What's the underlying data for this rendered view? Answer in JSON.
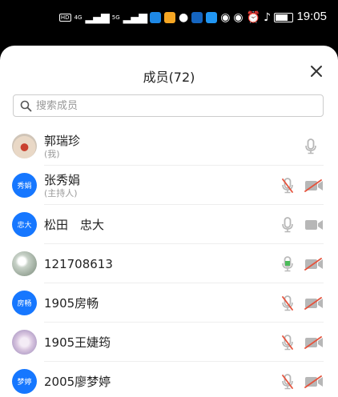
{
  "status": {
    "time": "19:05",
    "signal_a": "4G",
    "signal_b": "5G"
  },
  "header": {
    "title": "成员(72)",
    "close": "✕"
  },
  "search": {
    "placeholder": "搜索成员"
  },
  "members": [
    {
      "name": "郭瑞珍",
      "sub": "(我)",
      "avatar": "photo1",
      "avatar_text": "",
      "mic": "gray",
      "cam": "none"
    },
    {
      "name": "张秀娟",
      "sub": "(主持人)",
      "avatar": "blue",
      "avatar_text": "秀娟",
      "mic": "muted",
      "cam": "off"
    },
    {
      "name": "松田　忠大",
      "sub": "",
      "avatar": "blue",
      "avatar_text": "忠大",
      "mic": "gray",
      "cam": "on"
    },
    {
      "name": "121708613",
      "sub": "",
      "avatar": "photo2",
      "avatar_text": "",
      "mic": "green",
      "cam": "off"
    },
    {
      "name": "1905房畅",
      "sub": "",
      "avatar": "blue",
      "avatar_text": "房畅",
      "mic": "muted",
      "cam": "off"
    },
    {
      "name": "1905王婕筠",
      "sub": "",
      "avatar": "photo3",
      "avatar_text": "",
      "mic": "muted",
      "cam": "off"
    },
    {
      "name": "2005廖梦婷",
      "sub": "",
      "avatar": "blue",
      "avatar_text": "梦婷",
      "mic": "muted",
      "cam": "off"
    }
  ]
}
